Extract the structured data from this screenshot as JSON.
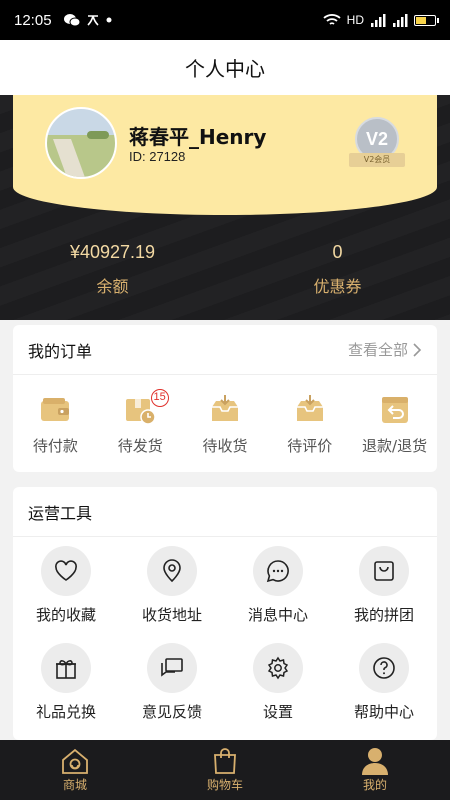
{
  "status": {
    "time": "12:05",
    "network": "HD",
    "signal": "4G"
  },
  "title": "个人中心",
  "profile": {
    "name": "蒋春平_Henry",
    "id": "ID: 27128",
    "vip_level": "V2",
    "vip_label": "V2会员"
  },
  "stats": [
    {
      "value": "¥40927.19",
      "label": "余额"
    },
    {
      "value": "0",
      "label": "优惠券"
    }
  ],
  "orders": {
    "title": "我的订单",
    "view_all": "查看全部",
    "pending_ship_count": "15",
    "items": [
      {
        "label": "待付款",
        "icon": "wallet-icon"
      },
      {
        "label": "待发货",
        "icon": "package-clock-icon"
      },
      {
        "label": "待收货",
        "icon": "inbox-download-icon"
      },
      {
        "label": "待评价",
        "icon": "review-box-icon"
      },
      {
        "label": "退款/退货",
        "icon": "return-icon"
      }
    ]
  },
  "tools": {
    "title": "运营工具",
    "items": [
      {
        "label": "我的收藏",
        "icon": "heart-icon"
      },
      {
        "label": "收货地址",
        "icon": "location-pin-icon"
      },
      {
        "label": "消息中心",
        "icon": "chat-bubble-icon"
      },
      {
        "label": "我的拼团",
        "icon": "shopping-bag-icon"
      },
      {
        "label": "礼品兑换",
        "icon": "gift-icon"
      },
      {
        "label": "意见反馈",
        "icon": "feedback-icon"
      },
      {
        "label": "设置",
        "icon": "gear-icon"
      },
      {
        "label": "帮助中心",
        "icon": "question-icon"
      }
    ]
  },
  "tabbar": [
    {
      "label": "商城",
      "icon": "home-icon"
    },
    {
      "label": "购物车",
      "icon": "cart-bag-icon"
    },
    {
      "label": "我的",
      "icon": "user-icon",
      "active": true
    }
  ],
  "colors": {
    "accent": "#d8b06e",
    "card_yellow": "#fde9a3",
    "dark_bg": "#1d1d1f",
    "badge_red": "#e0312c"
  }
}
